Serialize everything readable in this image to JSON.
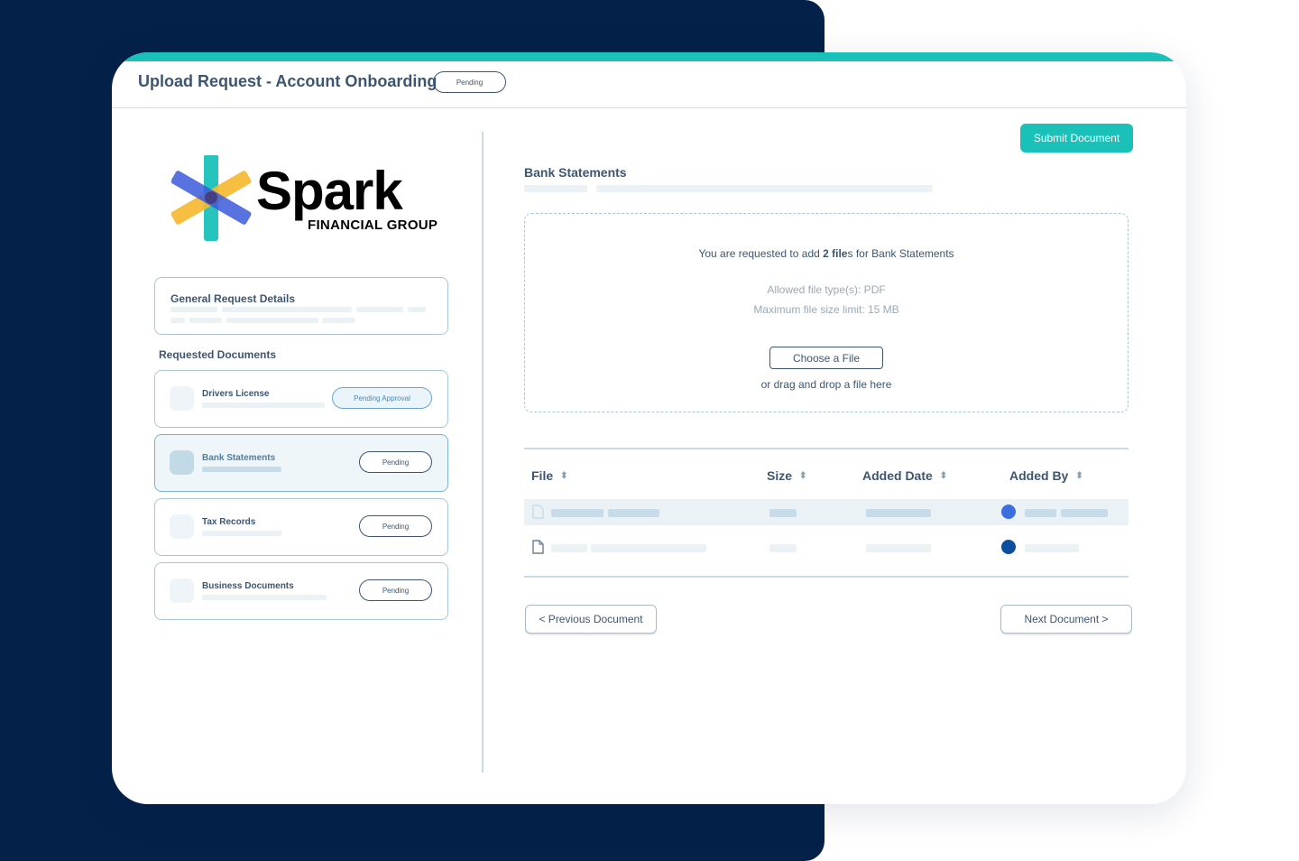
{
  "header": {
    "title": "Upload Request - Account Onboarding",
    "status": "Pending"
  },
  "logo": {
    "word": "Spark",
    "sub": "FINANCIAL GROUP"
  },
  "general": {
    "title": "General Request Details"
  },
  "requested": {
    "label": "Requested Documents",
    "items": [
      {
        "name": "Drivers License",
        "status": "Pending Approval"
      },
      {
        "name": "Bank Statements",
        "status": "Pending"
      },
      {
        "name": "Tax Records",
        "status": "Pending"
      },
      {
        "name": "Business Documents",
        "status": "Pending"
      }
    ]
  },
  "toolbar": {
    "submit_label": "Submit Document"
  },
  "section": {
    "title": "Bank Statements"
  },
  "dropzone": {
    "request_prefix": "You are requested to add ",
    "request_bold": "2 file",
    "request_suffix": "s for Bank Statements",
    "allowed": "Allowed file type(s): PDF",
    "max_size": "Maximum file size limit: 15 MB",
    "choose_label": "Choose a File",
    "drag_hint": "or drag and drop a file here"
  },
  "table": {
    "columns": [
      "File",
      "Size",
      "Added Date",
      "Added By"
    ]
  },
  "nav": {
    "prev": "< Previous Document",
    "next": "Next Document >"
  },
  "colors": {
    "navy": "#042149",
    "teal": "#1ac1b9",
    "text": "#3d5670",
    "dot_blue": "#3b6fe0",
    "dot_navy": "#0d4f9e"
  }
}
